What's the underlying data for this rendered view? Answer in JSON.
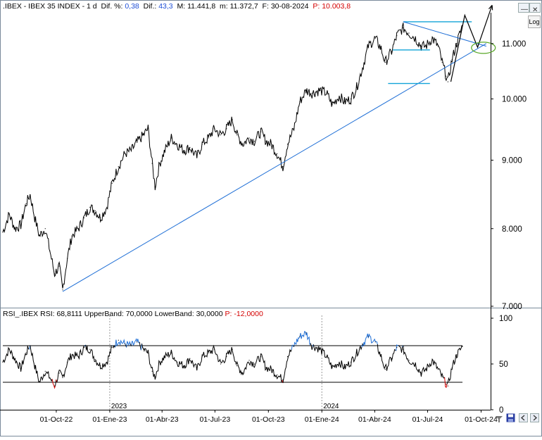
{
  "header": {
    "symbol": ".IBEX - IBEX 35 INDEX - 1 d",
    "dif_pct_label": "Dif. %:",
    "dif_pct_value": "0,38",
    "dif_label": "Dif.:",
    "dif_value": "43,3",
    "max_label": "M:",
    "max_value": "11.441,8",
    "min_label": "m:",
    "min_value": "11.372,7",
    "date_label": "F:",
    "date_value": "30-08-2024",
    "p_label": "P:",
    "p_value": "10.003,8"
  },
  "rsi_header": {
    "name": "RSI_.IBEX",
    "rsi_label": "RSI:",
    "rsi_value": "68,8111",
    "upper_label": "UpperBand:",
    "upper_value": "70,0000",
    "lower_label": "LowerBand:",
    "lower_value": "30,0000",
    "p_label": "P:",
    "p_value": "-12,0000"
  },
  "controls": {
    "log_label": "Log",
    "minus_label": "—",
    "close_label": "✕"
  },
  "colors": {
    "price": "#000000",
    "trendline": "#1f6fd6",
    "channel": "#12a4d8",
    "rsi_overbought": "#1f6fd6",
    "rsi_oversold": "#d40000",
    "ellipse": "#5aa829",
    "grid": "#000000"
  },
  "chart_data": [
    {
      "type": "line",
      "title": "IBEX 35 INDEX",
      "y_scale": "log",
      "ylim": [
        7000,
        11600
      ],
      "y_ticks": [
        "11.000",
        "10.000",
        "9.000",
        "8.000",
        "7.000"
      ],
      "y_tick_values": [
        11000,
        10000,
        9000,
        8000,
        7000
      ],
      "xlim": [
        "2022-07-01",
        "2024-10-15"
      ],
      "series": [
        {
          "values": [
            {
              "x": "2022-07-01",
              "y": 7950
            },
            {
              "x": "2022-07-12",
              "y": 8200
            },
            {
              "x": "2022-07-22",
              "y": 8000
            },
            {
              "x": "2022-08-01",
              "y": 8050
            },
            {
              "x": "2022-08-10",
              "y": 8350
            },
            {
              "x": "2022-08-17",
              "y": 8480
            },
            {
              "x": "2022-08-25",
              "y": 8150
            },
            {
              "x": "2022-09-02",
              "y": 7900
            },
            {
              "x": "2022-09-12",
              "y": 8000
            },
            {
              "x": "2022-09-20",
              "y": 7700
            },
            {
              "x": "2022-09-28",
              "y": 7400
            },
            {
              "x": "2022-10-06",
              "y": 7500
            },
            {
              "x": "2022-10-12",
              "y": 7200
            },
            {
              "x": "2022-10-20",
              "y": 7600
            },
            {
              "x": "2022-10-28",
              "y": 7900
            },
            {
              "x": "2022-11-08",
              "y": 8000
            },
            {
              "x": "2022-11-18",
              "y": 8150
            },
            {
              "x": "2022-11-28",
              "y": 8300
            },
            {
              "x": "2022-12-07",
              "y": 8250
            },
            {
              "x": "2022-12-16",
              "y": 8150
            },
            {
              "x": "2022-12-27",
              "y": 8300
            },
            {
              "x": "2023-01-05",
              "y": 8650
            },
            {
              "x": "2023-01-16",
              "y": 8900
            },
            {
              "x": "2023-01-27",
              "y": 9100
            },
            {
              "x": "2023-02-07",
              "y": 9150
            },
            {
              "x": "2023-02-17",
              "y": 9280
            },
            {
              "x": "2023-02-28",
              "y": 9400
            },
            {
              "x": "2023-03-08",
              "y": 9500
            },
            {
              "x": "2023-03-15",
              "y": 8950
            },
            {
              "x": "2023-03-20",
              "y": 8600
            },
            {
              "x": "2023-03-28",
              "y": 8950
            },
            {
              "x": "2023-04-06",
              "y": 9150
            },
            {
              "x": "2023-04-17",
              "y": 9350
            },
            {
              "x": "2023-04-27",
              "y": 9250
            },
            {
              "x": "2023-05-09",
              "y": 9150
            },
            {
              "x": "2023-05-19",
              "y": 9200
            },
            {
              "x": "2023-05-31",
              "y": 9050
            },
            {
              "x": "2023-06-09",
              "y": 9250
            },
            {
              "x": "2023-06-20",
              "y": 9350
            },
            {
              "x": "2023-06-30",
              "y": 9500
            },
            {
              "x": "2023-07-11",
              "y": 9400
            },
            {
              "x": "2023-07-21",
              "y": 9500
            },
            {
              "x": "2023-07-31",
              "y": 9650
            },
            {
              "x": "2023-08-08",
              "y": 9400
            },
            {
              "x": "2023-08-18",
              "y": 9250
            },
            {
              "x": "2023-08-29",
              "y": 9350
            },
            {
              "x": "2023-09-07",
              "y": 9300
            },
            {
              "x": "2023-09-18",
              "y": 9450
            },
            {
              "x": "2023-09-27",
              "y": 9300
            },
            {
              "x": "2023-10-06",
              "y": 9250
            },
            {
              "x": "2023-10-16",
              "y": 9100
            },
            {
              "x": "2023-10-26",
              "y": 8900
            },
            {
              "x": "2023-11-03",
              "y": 9250
            },
            {
              "x": "2023-11-14",
              "y": 9500
            },
            {
              "x": "2023-11-24",
              "y": 9950
            },
            {
              "x": "2023-12-05",
              "y": 10150
            },
            {
              "x": "2023-12-15",
              "y": 10100
            },
            {
              "x": "2023-12-29",
              "y": 10150
            },
            {
              "x": "2024-01-09",
              "y": 10100
            },
            {
              "x": "2024-01-19",
              "y": 9900
            },
            {
              "x": "2024-01-31",
              "y": 10050
            },
            {
              "x": "2024-02-09",
              "y": 9950
            },
            {
              "x": "2024-02-20",
              "y": 10000
            },
            {
              "x": "2024-03-01",
              "y": 10200
            },
            {
              "x": "2024-03-11",
              "y": 10550
            },
            {
              "x": "2024-03-21",
              "y": 10950
            },
            {
              "x": "2024-04-02",
              "y": 11100
            },
            {
              "x": "2024-04-12",
              "y": 10900
            },
            {
              "x": "2024-04-19",
              "y": 10650
            },
            {
              "x": "2024-04-30",
              "y": 10850
            },
            {
              "x": "2024-05-09",
              "y": 11150
            },
            {
              "x": "2024-05-20",
              "y": 11300
            },
            {
              "x": "2024-05-30",
              "y": 11200
            },
            {
              "x": "2024-06-10",
              "y": 11100
            },
            {
              "x": "2024-06-20",
              "y": 10950
            },
            {
              "x": "2024-06-28",
              "y": 10950
            },
            {
              "x": "2024-07-09",
              "y": 11100
            },
            {
              "x": "2024-07-19",
              "y": 10950
            },
            {
              "x": "2024-07-26",
              "y": 10650
            },
            {
              "x": "2024-08-02",
              "y": 10400
            },
            {
              "x": "2024-08-05",
              "y": 10300
            },
            {
              "x": "2024-08-12",
              "y": 10700
            },
            {
              "x": "2024-08-20",
              "y": 11000
            },
            {
              "x": "2024-08-30",
              "y": 11350
            }
          ]
        }
      ],
      "annotations": {
        "trendline": [
          {
            "x": "2022-10-12",
            "y": 7180
          },
          {
            "x": "2024-10-10",
            "y": 11000
          }
        ],
        "channel_top": [
          {
            "x": "2024-05-20",
            "y": 11420
          },
          {
            "x": "2024-09-15",
            "y": 11420
          }
        ],
        "channel_mid": [
          {
            "x": "2024-05-02",
            "y": 10880
          },
          {
            "x": "2024-07-05",
            "y": 10880
          }
        ],
        "channel_bottom": [
          {
            "x": "2024-04-24",
            "y": 10270
          },
          {
            "x": "2024-07-05",
            "y": 10270
          }
        ],
        "wedge_upper": [
          {
            "x": "2024-05-20",
            "y": 11420
          },
          {
            "x": "2024-10-10",
            "y": 10950
          }
        ],
        "projection": [
          {
            "x": "2024-08-10",
            "y": 10300
          },
          {
            "x": "2024-09-03",
            "y": 11550
          },
          {
            "x": "2024-09-25",
            "y": 10930
          },
          {
            "x": "2024-10-20",
            "y": 11750
          }
        ],
        "ellipse_center": {
          "x": "2024-10-05",
          "y": 10920
        }
      }
    },
    {
      "type": "line",
      "title": "RSI_.IBEX",
      "ylim": [
        0,
        100
      ],
      "y_ticks": [
        "100",
        "50",
        "0"
      ],
      "y_tick_values": [
        100,
        50,
        0
      ],
      "bands": [
        70,
        30
      ],
      "xlim": [
        "2022-07-01",
        "2024-10-15"
      ],
      "x_ticks": [
        "01-Oct-22",
        "01-Ene-23",
        "01-Abr-23",
        "01-Jul-23",
        "01-Oct-23",
        "01-Ene-24",
        "01-Abr-24",
        "01-Jul-24",
        "01-Oct-24"
      ],
      "x_tick_dates": [
        "2022-10-01",
        "2023-01-01",
        "2023-04-01",
        "2023-07-01",
        "2023-10-01",
        "2024-01-01",
        "2024-04-01",
        "2024-07-01",
        "2024-10-01"
      ],
      "year_labels": [
        "2023",
        "2024"
      ],
      "year_dates": [
        "2023-01-01",
        "2024-01-01"
      ],
      "series": [
        {
          "values": [
            {
              "x": "2022-07-01",
              "y": 52
            },
            {
              "x": "2022-07-12",
              "y": 66
            },
            {
              "x": "2022-07-22",
              "y": 55
            },
            {
              "x": "2022-08-01",
              "y": 45
            },
            {
              "x": "2022-08-10",
              "y": 62
            },
            {
              "x": "2022-08-17",
              "y": 70
            },
            {
              "x": "2022-08-25",
              "y": 48
            },
            {
              "x": "2022-09-02",
              "y": 30
            },
            {
              "x": "2022-09-12",
              "y": 42
            },
            {
              "x": "2022-09-20",
              "y": 35
            },
            {
              "x": "2022-09-28",
              "y": 26
            },
            {
              "x": "2022-10-06",
              "y": 40
            },
            {
              "x": "2022-10-12",
              "y": 35
            },
            {
              "x": "2022-10-20",
              "y": 52
            },
            {
              "x": "2022-10-28",
              "y": 60
            },
            {
              "x": "2022-11-08",
              "y": 58
            },
            {
              "x": "2022-11-18",
              "y": 68
            },
            {
              "x": "2022-11-28",
              "y": 66
            },
            {
              "x": "2022-12-07",
              "y": 55
            },
            {
              "x": "2022-12-16",
              "y": 48
            },
            {
              "x": "2022-12-27",
              "y": 52
            },
            {
              "x": "2023-01-05",
              "y": 68
            },
            {
              "x": "2023-01-16",
              "y": 76
            },
            {
              "x": "2023-01-27",
              "y": 72
            },
            {
              "x": "2023-02-07",
              "y": 70
            },
            {
              "x": "2023-02-17",
              "y": 74
            },
            {
              "x": "2023-02-28",
              "y": 66
            },
            {
              "x": "2023-03-08",
              "y": 62
            },
            {
              "x": "2023-03-15",
              "y": 42
            },
            {
              "x": "2023-03-20",
              "y": 36
            },
            {
              "x": "2023-03-28",
              "y": 52
            },
            {
              "x": "2023-04-06",
              "y": 58
            },
            {
              "x": "2023-04-17",
              "y": 62
            },
            {
              "x": "2023-04-27",
              "y": 52
            },
            {
              "x": "2023-05-09",
              "y": 48
            },
            {
              "x": "2023-05-19",
              "y": 56
            },
            {
              "x": "2023-05-31",
              "y": 44
            },
            {
              "x": "2023-06-09",
              "y": 58
            },
            {
              "x": "2023-06-20",
              "y": 62
            },
            {
              "x": "2023-06-30",
              "y": 66
            },
            {
              "x": "2023-07-11",
              "y": 50
            },
            {
              "x": "2023-07-21",
              "y": 58
            },
            {
              "x": "2023-07-31",
              "y": 66
            },
            {
              "x": "2023-08-08",
              "y": 48
            },
            {
              "x": "2023-08-18",
              "y": 40
            },
            {
              "x": "2023-08-29",
              "y": 54
            },
            {
              "x": "2023-09-07",
              "y": 50
            },
            {
              "x": "2023-09-18",
              "y": 58
            },
            {
              "x": "2023-09-27",
              "y": 46
            },
            {
              "x": "2023-10-06",
              "y": 44
            },
            {
              "x": "2023-10-16",
              "y": 38
            },
            {
              "x": "2023-10-26",
              "y": 33
            },
            {
              "x": "2023-11-03",
              "y": 58
            },
            {
              "x": "2023-11-14",
              "y": 70
            },
            {
              "x": "2023-11-24",
              "y": 80
            },
            {
              "x": "2023-12-05",
              "y": 84
            },
            {
              "x": "2023-12-15",
              "y": 70
            },
            {
              "x": "2023-12-29",
              "y": 66
            },
            {
              "x": "2024-01-09",
              "y": 58
            },
            {
              "x": "2024-01-19",
              "y": 46
            },
            {
              "x": "2024-01-31",
              "y": 52
            },
            {
              "x": "2024-02-09",
              "y": 46
            },
            {
              "x": "2024-02-20",
              "y": 52
            },
            {
              "x": "2024-03-01",
              "y": 62
            },
            {
              "x": "2024-03-11",
              "y": 72
            },
            {
              "x": "2024-03-21",
              "y": 80
            },
            {
              "x": "2024-04-02",
              "y": 74
            },
            {
              "x": "2024-04-12",
              "y": 58
            },
            {
              "x": "2024-04-19",
              "y": 44
            },
            {
              "x": "2024-04-30",
              "y": 56
            },
            {
              "x": "2024-05-09",
              "y": 68
            },
            {
              "x": "2024-05-20",
              "y": 66
            },
            {
              "x": "2024-05-30",
              "y": 54
            },
            {
              "x": "2024-06-10",
              "y": 50
            },
            {
              "x": "2024-06-20",
              "y": 40
            },
            {
              "x": "2024-06-28",
              "y": 44
            },
            {
              "x": "2024-07-09",
              "y": 54
            },
            {
              "x": "2024-07-19",
              "y": 44
            },
            {
              "x": "2024-07-26",
              "y": 36
            },
            {
              "x": "2024-08-02",
              "y": 28
            },
            {
              "x": "2024-08-05",
              "y": 26
            },
            {
              "x": "2024-08-12",
              "y": 46
            },
            {
              "x": "2024-08-20",
              "y": 60
            },
            {
              "x": "2024-08-30",
              "y": 69
            }
          ]
        }
      ]
    }
  ]
}
